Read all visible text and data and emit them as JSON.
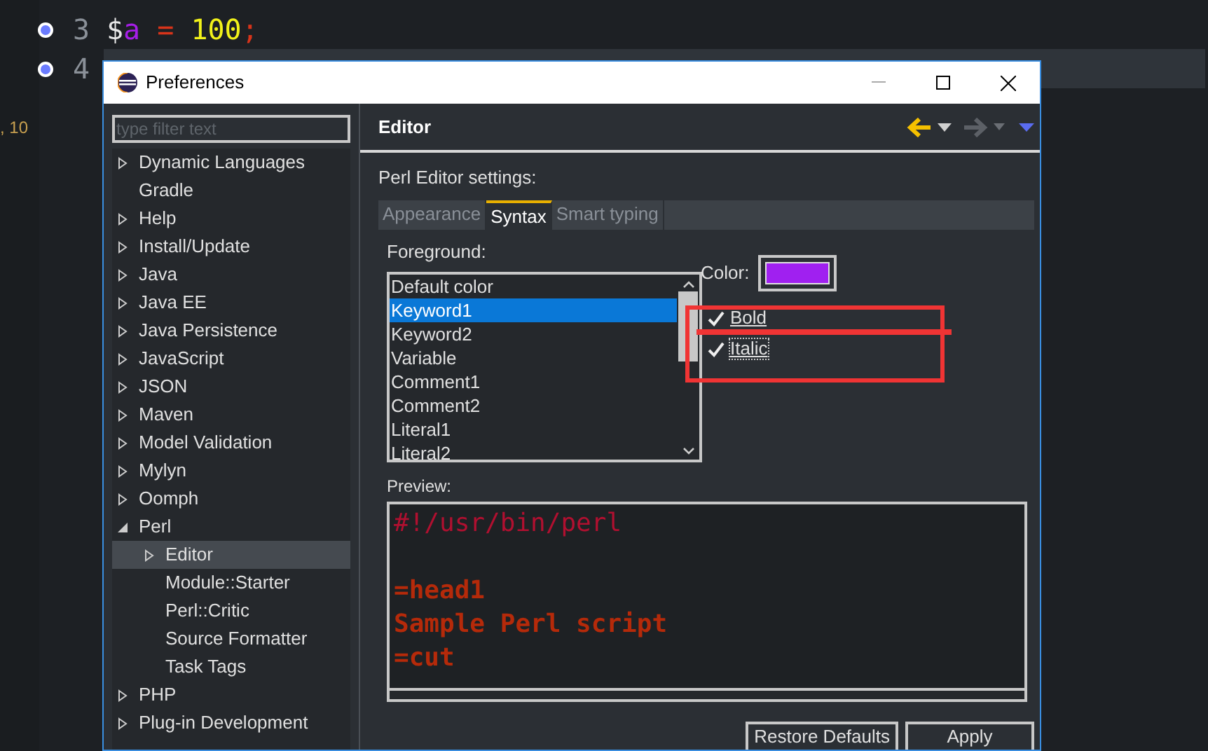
{
  "editor": {
    "lines": [
      {
        "number": "3",
        "breakpoint": true,
        "current": false,
        "tokens": [
          {
            "text": "$",
            "color": "#e8e8e8"
          },
          {
            "text": "a",
            "color": "#a61ee8"
          },
          {
            "text": " = ",
            "color": "#d8341a"
          },
          {
            "text": "100",
            "color": "#f2f21a"
          },
          {
            "text": ";",
            "color": "#d8341a"
          }
        ]
      },
      {
        "number": "4",
        "breakpoint": true,
        "current": true
      }
    ],
    "side_text": ", 10"
  },
  "dialog": {
    "title": "Preferences",
    "filter": {
      "placeholder": "type filter text"
    },
    "tree": [
      {
        "label": "Dynamic Languages",
        "expanded": false,
        "selected": false
      },
      {
        "label": "Gradle",
        "selected": false
      },
      {
        "label": "Help",
        "expanded": false,
        "selected": false
      },
      {
        "label": "Install/Update",
        "expanded": false,
        "selected": false
      },
      {
        "label": "Java",
        "expanded": false,
        "selected": false
      },
      {
        "label": "Java EE",
        "expanded": false,
        "selected": false
      },
      {
        "label": "Java Persistence",
        "expanded": false,
        "selected": false
      },
      {
        "label": "JavaScript",
        "expanded": false,
        "selected": false
      },
      {
        "label": "JSON",
        "expanded": false,
        "selected": false
      },
      {
        "label": "Maven",
        "expanded": false,
        "selected": false
      },
      {
        "label": "Model Validation",
        "expanded": false,
        "selected": false
      },
      {
        "label": "Mylyn",
        "expanded": false,
        "selected": false
      },
      {
        "label": "Oomph",
        "expanded": false,
        "selected": false
      },
      {
        "label": "Perl",
        "expanded": true,
        "selected": false,
        "children": [
          {
            "label": "Editor",
            "expanded": false,
            "selected": true
          },
          {
            "label": "Module::Starter",
            "selected": false
          },
          {
            "label": "Perl::Critic",
            "selected": false
          },
          {
            "label": "Source Formatter",
            "selected": false
          },
          {
            "label": "Task Tags",
            "selected": false
          }
        ]
      },
      {
        "label": "PHP",
        "expanded": false,
        "selected": false
      },
      {
        "label": "Plug-in Development",
        "expanded": false,
        "selected": false
      }
    ],
    "page_title": "Editor",
    "settings_label": "Perl Editor settings:",
    "tabs": [
      {
        "label": "Appearance",
        "selected": false
      },
      {
        "label": "Syntax",
        "selected": true
      },
      {
        "label": "Smart typing",
        "selected": false
      }
    ],
    "foreground_label": "Foreground:",
    "foreground_items": [
      {
        "label": "Default color",
        "selected": false
      },
      {
        "label": "Keyword1",
        "selected": true
      },
      {
        "label": "Keyword2",
        "selected": false
      },
      {
        "label": "Variable",
        "selected": false
      },
      {
        "label": "Comment1",
        "selected": false
      },
      {
        "label": "Comment2",
        "selected": false
      },
      {
        "label": "Literal1",
        "selected": false
      },
      {
        "label": "Literal2",
        "selected": false
      }
    ],
    "color_label": "Color:",
    "color_value": {
      "color": "#a020f0"
    },
    "checkboxes": [
      {
        "label": "Bold",
        "checked": true,
        "focused": false
      },
      {
        "label": "Italic",
        "checked": true,
        "focused": true
      }
    ],
    "preview_label": "Preview:",
    "preview_lines": [
      {
        "kind": "comment",
        "text": "#!/usr/bin/perl"
      },
      {
        "kind": "blank"
      },
      {
        "kind": "pod",
        "text": "=head1"
      },
      {
        "kind": "pod",
        "text": "Sample Perl script"
      },
      {
        "kind": "pod",
        "text": "=cut"
      }
    ],
    "buttons": [
      "Restore Defaults",
      "Apply"
    ]
  }
}
